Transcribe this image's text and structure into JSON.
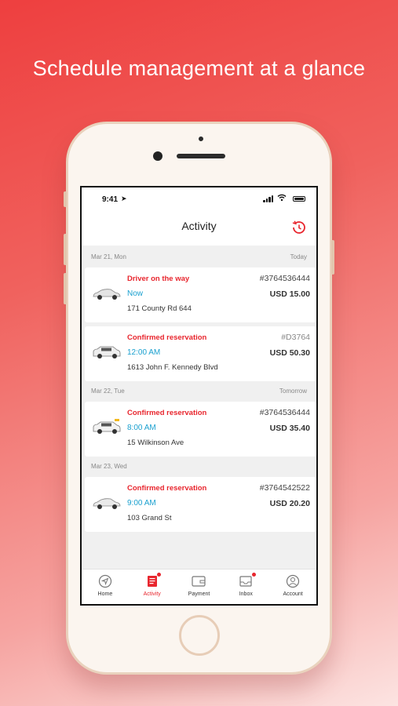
{
  "headline": "Schedule management at a glance",
  "status_bar": {
    "time": "9:41"
  },
  "screen": {
    "title": "Activity",
    "sections": [
      {
        "date": "Mar 21, Mon",
        "relative": "Today",
        "items": [
          {
            "status": "Driver on the way",
            "when": "Now",
            "address": "171 County Rd 644",
            "ref": "#3764536444",
            "price": "USD 15.00",
            "car": "sedan-icon"
          },
          {
            "status": "Confirmed reservation",
            "when": "12:00 AM",
            "address": "1613 John F. Kennedy Blvd",
            "ref": "#D3764",
            "price": "USD 50.30",
            "car": "suv-icon"
          }
        ]
      },
      {
        "date": "Mar 22, Tue",
        "relative": "Tomorrow",
        "items": [
          {
            "status": "Confirmed reservation",
            "when": "8:00 AM",
            "address": "15 Wilkinson Ave",
            "ref": "#3764536444",
            "price": "USD 35.40",
            "car": "taxi-icon"
          }
        ]
      },
      {
        "date": "Mar 23, Wed",
        "relative": "",
        "items": [
          {
            "status": "Confirmed reservation",
            "when": "9:00 AM",
            "address": "103 Grand St",
            "ref": "#3764542522",
            "price": "USD 20.20",
            "car": "sedan-icon"
          }
        ]
      }
    ]
  },
  "tabs": [
    {
      "label": "Home",
      "icon": "compass-icon",
      "active": false,
      "badge": false
    },
    {
      "label": "Activity",
      "icon": "receipt-icon",
      "active": true,
      "badge": true
    },
    {
      "label": "Payment",
      "icon": "wallet-icon",
      "active": false,
      "badge": false
    },
    {
      "label": "Inbox",
      "icon": "inbox-icon",
      "active": false,
      "badge": true
    },
    {
      "label": "Account",
      "icon": "account-icon",
      "active": false,
      "badge": false
    }
  ],
  "colors": {
    "accent": "#e8262e",
    "time_blue": "#1aa0cf",
    "background_top": "#ee3f3f"
  }
}
